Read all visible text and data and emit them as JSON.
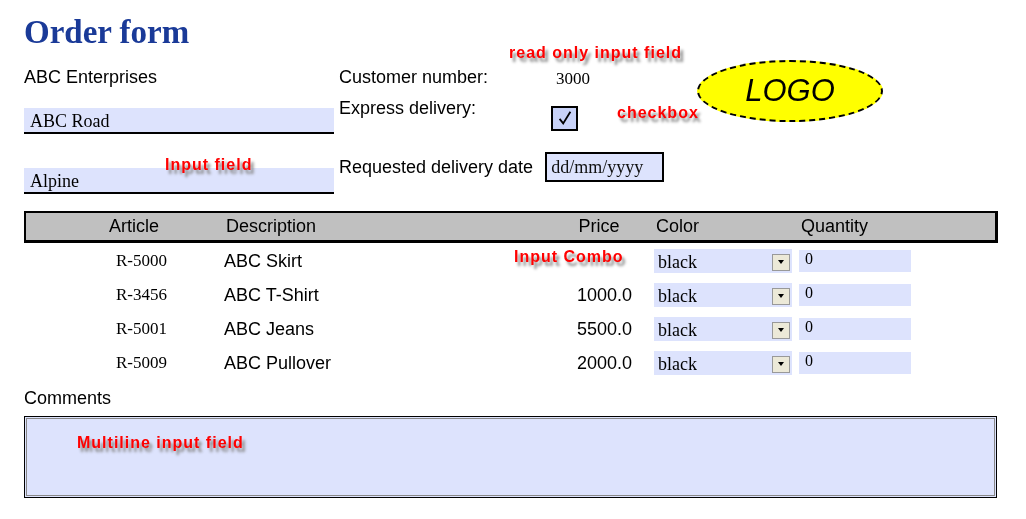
{
  "title": "Order form",
  "company": "ABC Enterprises",
  "address_fields": [
    {
      "value": "ABC Road"
    },
    {
      "value": "Alpine",
      "annotation": "Input field"
    }
  ],
  "customer_number": {
    "label": "Customer number:",
    "value": "3000",
    "annotation": "read only input field"
  },
  "express_delivery": {
    "label": "Express delivery:",
    "checked": true,
    "annotation": "checkbox"
  },
  "delivery_date": {
    "label": "Requested delivery date",
    "placeholder": "dd/mm/yyyy"
  },
  "logo": "LOGO",
  "table": {
    "columns": [
      "Article",
      "Description",
      "Price",
      "Color",
      "Quantity"
    ],
    "annotation": "Input Combo",
    "rows": [
      {
        "article": "R-5000",
        "description": "ABC Skirt",
        "color_choice": "black",
        "quantity": "0"
      },
      {
        "article": "R-3456",
        "description": "ABC T-Shirt",
        "price": "1000.0",
        "color_choice": "black",
        "quantity": "0"
      },
      {
        "article": "R-5001",
        "description": "ABC Jeans",
        "price": "5500.0",
        "color_choice": "black",
        "quantity": "0"
      },
      {
        "article": "R-5009",
        "description": "ABC Pullover",
        "price": "2000.0",
        "color_choice": "black",
        "quantity": "0"
      }
    ]
  },
  "comments": {
    "label": "Comments",
    "annotation": "Multiline input field"
  }
}
